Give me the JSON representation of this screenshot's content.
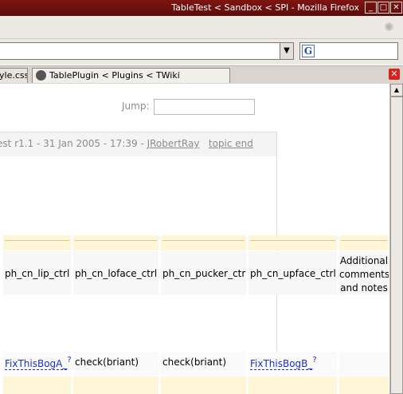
{
  "window": {
    "title": "TableTest < Sandbox < SPI - Mozilla Firefox"
  },
  "titlebar_buttons": {
    "minimize": "_",
    "maximize": "□",
    "close": "✕"
  },
  "toolbar": {
    "throbber_icon": "throbber-icon"
  },
  "urlbar": {
    "url": "",
    "dropdown_glyph": "▼"
  },
  "search": {
    "engine_icon": "G",
    "value": ""
  },
  "tabs": [
    {
      "label": "yle.css"
    },
    {
      "label": "TablePlugin < Plugins < TWiki"
    }
  ],
  "tab_close_glyph": "✕",
  "jump": {
    "label": "Jump:",
    "value": ""
  },
  "revinfo": {
    "text": "est   r1.1 - 31 Jan 2005 - 17:39 - ",
    "author": "JRobertRay",
    "topic_end": "topic end"
  },
  "table": {
    "header_labels": [
      "ph_cn_lip_ctrl",
      "ph_cn_loface_ctrl",
      "ph_cn_pucker_ctrl",
      "ph_cn_upface_ctrl",
      "Additional comments and notes"
    ],
    "row": [
      {
        "text": "FixThisBogA_",
        "wikiword": true,
        "q": "?"
      },
      {
        "text": "check(briant)",
        "wikiword": false,
        "q": ""
      },
      {
        "text": "check(briant)",
        "wikiword": false,
        "q": ""
      },
      {
        "text": "FixThisBogB_",
        "wikiword": true,
        "q": "?"
      },
      {
        "text": "",
        "wikiword": false,
        "q": ""
      }
    ]
  },
  "scrollbar": {
    "up_glyph": "▲"
  },
  "colors": {
    "titlebar": "#7f1411",
    "table_header_bg": "#fff6d8",
    "wikilink": "#1b30c8"
  }
}
